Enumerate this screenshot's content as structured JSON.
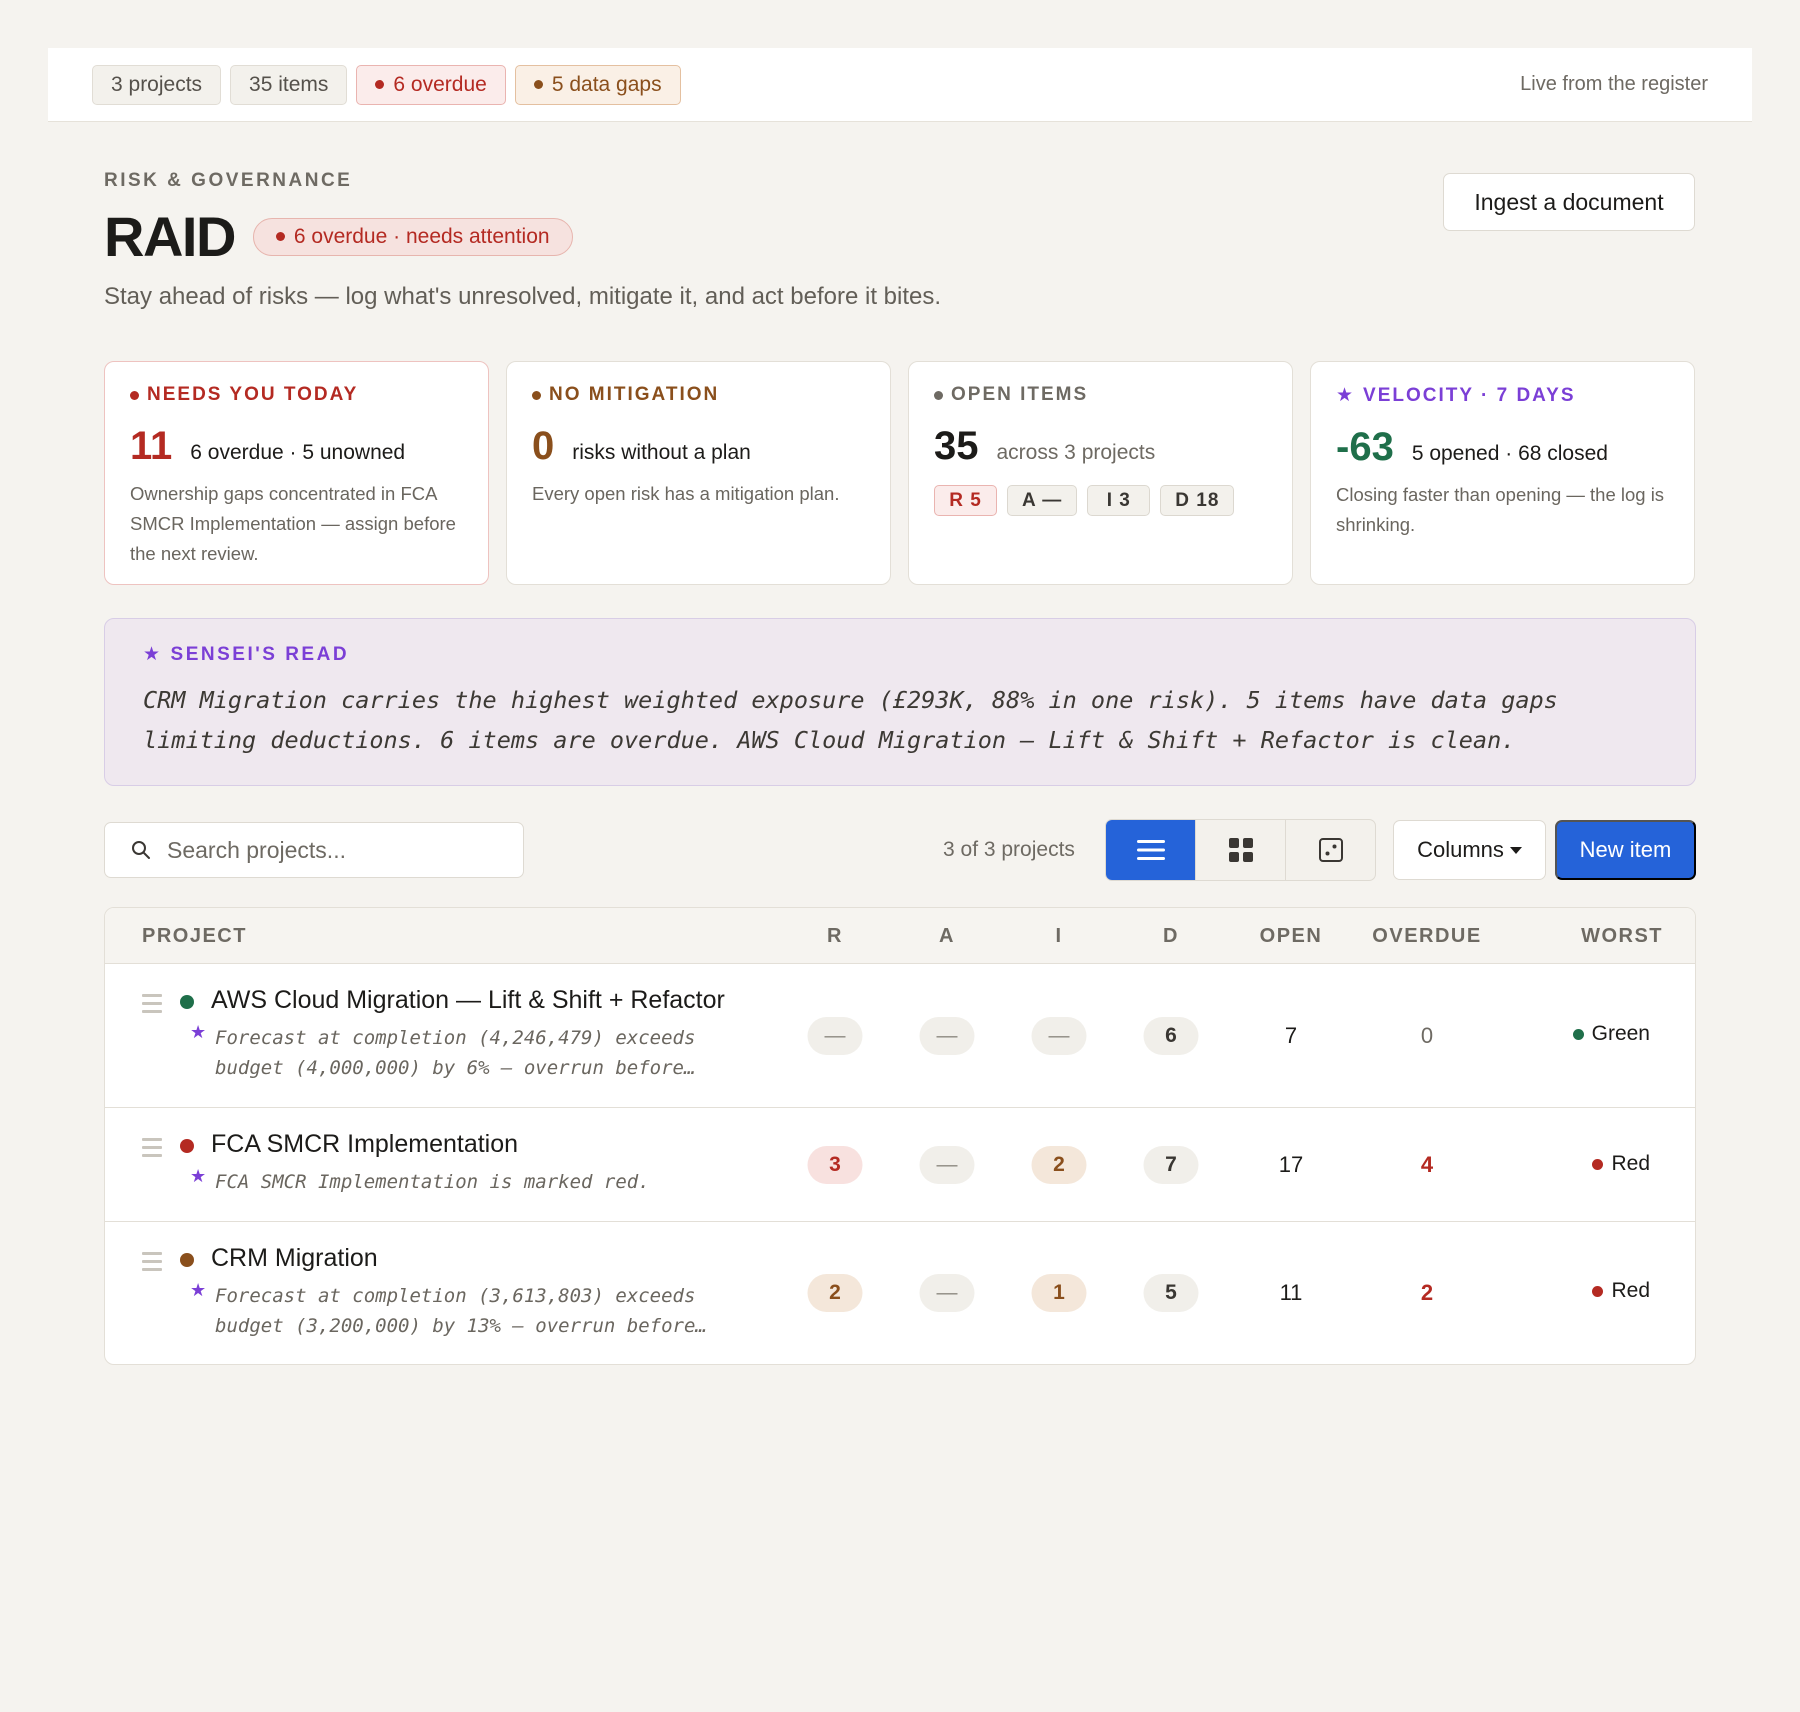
{
  "topbar": {
    "chips": [
      {
        "label": "3 projects",
        "tone": "neutral"
      },
      {
        "label": "35 items",
        "tone": "neutral"
      },
      {
        "label": "6 overdue",
        "tone": "red"
      },
      {
        "label": "5 data gaps",
        "tone": "amber"
      }
    ],
    "live_label": "Live from the register"
  },
  "header": {
    "eyebrow": "RISK & GOVERNANCE",
    "title": "RAID",
    "attention_pill": "6 overdue · needs attention",
    "subtitle": "Stay ahead of risks — log what's unresolved, mitigate it, and act before it bites.",
    "ingest_button": "Ingest a document"
  },
  "cards": [
    {
      "label": "NEEDS YOU TODAY",
      "icon": "dot",
      "color": "#b42a22",
      "number": "11",
      "number_color": "#b42a22",
      "sub": "6 overdue · 5 unowned",
      "desc": "Ownership gaps concentrated in FCA SMCR Implementation — assign before the next review."
    },
    {
      "label": "NO MITIGATION",
      "icon": "dot",
      "color": "#8a4f1c",
      "number": "0",
      "number_color": "#8a4f1c",
      "sub": "risks without a plan",
      "desc": "Every open risk has a mitigation plan."
    },
    {
      "label": "OPEN ITEMS",
      "icon": "dot",
      "color": "#6e6a63",
      "number": "35",
      "number_color": "#1c1b19",
      "sub": "across 3 projects",
      "chips": [
        {
          "label": "R 5",
          "tone": "red"
        },
        {
          "label": "A —",
          "tone": "neutral"
        },
        {
          "label": "I 3",
          "tone": "neutral"
        },
        {
          "label": "D 18",
          "tone": "neutral"
        }
      ]
    },
    {
      "label": "VELOCITY · 7 DAYS",
      "icon": "star",
      "color": "#7b3fd6",
      "number": "-63",
      "number_color": "#1f6f4a",
      "sub": "5 opened · 68 closed",
      "desc": "Closing faster than opening — the log is shrinking."
    }
  ],
  "sensei": {
    "label": "SENSEI'S READ",
    "text": "CRM Migration carries the highest weighted exposure (£293K, 88% in one risk). 5 items have data gaps limiting deductions. 6 items are overdue. AWS Cloud Migration — Lift & Shift + Refactor is clean."
  },
  "toolbar": {
    "search_placeholder": "Search projects...",
    "count_text": "3 of 3 projects",
    "view_icons": [
      "list-view-icon",
      "grid-view-icon",
      "matrix-view-icon"
    ],
    "columns_label": "Columns",
    "new_item_label": "New item"
  },
  "table": {
    "headers": {
      "project": "PROJECT",
      "r": "R",
      "a": "A",
      "i": "I",
      "d": "D",
      "open": "OPEN",
      "overdue": "OVERDUE",
      "worst": "WORST"
    },
    "rows": [
      {
        "name": "AWS Cloud Migration — Lift & Shift + Refactor",
        "status_color": "#1f6f4a",
        "note": "Forecast at completion (4,246,479) exceeds budget (4,000,000) by 6% — overrun before…",
        "r": "—",
        "a": "—",
        "i": "—",
        "d": "6",
        "open": "7",
        "overdue": "0",
        "worst": "Green",
        "worst_color": "#1f6f4a"
      },
      {
        "name": "FCA SMCR Implementation",
        "status_color": "#b42a22",
        "note": "FCA SMCR Implementation is marked red.",
        "r": "3",
        "a": "—",
        "i": "2",
        "d": "7",
        "open": "17",
        "overdue": "4",
        "worst": "Red",
        "worst_color": "#b42a22"
      },
      {
        "name": "CRM Migration",
        "status_color": "#8a4f1c",
        "note": "Forecast at completion (3,613,803) exceeds budget (3,200,000) by 13% — overrun before…",
        "r": "2",
        "a": "—",
        "i": "1",
        "d": "5",
        "open": "11",
        "overdue": "2",
        "worst": "Red",
        "worst_color": "#b42a22"
      }
    ]
  }
}
